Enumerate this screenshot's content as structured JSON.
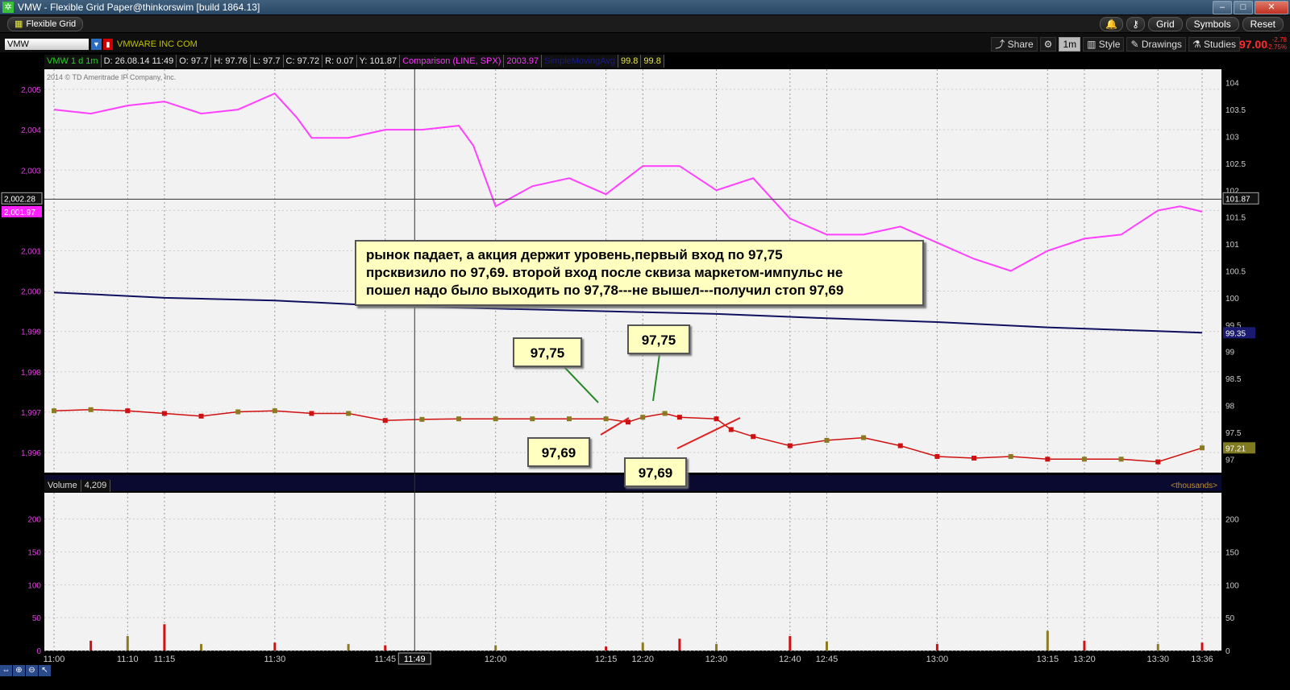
{
  "window": {
    "title": "VMW - Flexible Grid Paper@thinkorswim [build 1864.13]",
    "app_icon": "thinkorswim-icon"
  },
  "toolbar": {
    "grid_tab": "Flexible Grid",
    "buttons": [
      "Grid",
      "Symbols",
      "Reset"
    ],
    "symbol": "VMW",
    "symbol_name": "VMWARE INC COM",
    "share": "Share",
    "interval": "1m",
    "style": "Style",
    "drawings": "Drawings",
    "studies": "Studies",
    "last_price": "97.00",
    "change": "-2.78",
    "change_pct": "-2.75%"
  },
  "info_bar": {
    "label": "VMW 1 d 1m",
    "date": "D: 26.08.14 11:49",
    "open": "O: 97.7",
    "high": "H: 97.76",
    "low": "L: 97.7",
    "close": "C: 97.72",
    "range": "R: 0.07",
    "y": "Y: 101.87",
    "comparison": "Comparison (LINE, SPX)",
    "comparison_value": "2003.97",
    "ma_label": "SimpleMovingAvg",
    "v1": "99.8",
    "v2": "99.8"
  },
  "copyright": "2014 © TD Ameritrade IP Company, Inc.",
  "colors": {
    "comparison_line": "#ff40ff",
    "moving_average": "#101060",
    "up_candle": "#8a7a20",
    "down_candle": "#d01010",
    "price_tag": "#ff20ff",
    "accent_red": "#ff2a2a",
    "panel_bg": "#f2f2f2"
  },
  "left_axis": [
    "2,005",
    "2,004",
    "2,003",
    "2,002",
    "2,001",
    "2,000",
    "1,999",
    "1,998",
    "1,997",
    "1,996"
  ],
  "right_axis": [
    "104",
    "103.5",
    "103",
    "102.5",
    "102",
    "101.5",
    "101",
    "100.5",
    "100",
    "99.5",
    "99",
    "98.5",
    "98",
    "97.5",
    "97"
  ],
  "price_tags": {
    "crosshair_left": "2,002.28",
    "comparison_left": "2,001.97",
    "crosshair_right": "101.87",
    "ma_right": "99.35",
    "close_right": "97.21"
  },
  "annotation": {
    "lines": [
      "рынок падает, а акция держит уровень,первый вход по 97,75",
      "прсквизило по 97,69. второй вход после сквиза маркетом-импульс не",
      "пошел надо было выходить по 97,78---не вышел---получил стоп 97,69"
    ]
  },
  "tags": [
    "97,75",
    "97,75",
    "97,69",
    "97,69"
  ],
  "volume": {
    "label": "Volume",
    "value": "4,209",
    "unit": "<thousands>",
    "axis": [
      "200",
      "150",
      "100",
      "50",
      "0"
    ]
  },
  "time_axis": [
    "11:00",
    "11:10",
    "11:15",
    "11:30",
    "11:45",
    "12:00",
    "12:15",
    "12:20",
    "12:30",
    "12:40",
    "12:45",
    "13:00",
    "13:15",
    "13:20",
    "13:30",
    "13:36"
  ],
  "crosshair_time": "11:49",
  "chart_data": {
    "type": "line",
    "title": "VMW 1 d 1m",
    "x_range": [
      "11:00",
      "13:36"
    ],
    "series": [
      {
        "name": "Comparison (LINE, SPX)",
        "axis": "left",
        "x": [
          "11:00",
          "11:05",
          "11:10",
          "11:15",
          "11:20",
          "11:25",
          "11:30",
          "11:33",
          "11:35",
          "11:40",
          "11:45",
          "11:50",
          "11:55",
          "11:57",
          "12:00",
          "12:05",
          "12:10",
          "12:15",
          "12:20",
          "12:25",
          "12:30",
          "12:35",
          "12:40",
          "12:45",
          "12:50",
          "12:55",
          "13:00",
          "13:05",
          "13:10",
          "13:15",
          "13:20",
          "13:25",
          "13:30",
          "13:33",
          "13:36"
        ],
        "values": [
          2004.5,
          2004.4,
          2004.6,
          2004.7,
          2004.4,
          2004.5,
          2004.9,
          2004.3,
          2003.8,
          2003.8,
          2004.0,
          2004.0,
          2004.1,
          2003.6,
          2002.1,
          2002.6,
          2002.8,
          2002.4,
          2003.1,
          2003.1,
          2002.5,
          2002.8,
          2001.8,
          2001.4,
          2001.4,
          2001.6,
          2001.2,
          2000.8,
          2000.5,
          2001.0,
          2001.3,
          2001.4,
          2002.0,
          2002.1,
          2001.97
        ]
      },
      {
        "name": "SimpleMovingAvg",
        "axis": "right",
        "x": [
          "11:00",
          "11:15",
          "11:30",
          "11:45",
          "12:00",
          "12:15",
          "12:30",
          "12:45",
          "13:00",
          "13:15",
          "13:30",
          "13:36"
        ],
        "values": [
          100.1,
          100.0,
          99.95,
          99.85,
          99.8,
          99.75,
          99.7,
          99.62,
          99.55,
          99.45,
          99.38,
          99.35
        ]
      },
      {
        "name": "VMW",
        "axis": "right",
        "x": [
          "11:00",
          "11:05",
          "11:10",
          "11:15",
          "11:20",
          "11:25",
          "11:30",
          "11:35",
          "11:40",
          "11:45",
          "11:50",
          "11:55",
          "12:00",
          "12:05",
          "12:10",
          "12:15",
          "12:18",
          "12:20",
          "12:23",
          "12:25",
          "12:30",
          "12:32",
          "12:35",
          "12:40",
          "12:45",
          "12:50",
          "12:55",
          "13:00",
          "13:05",
          "13:10",
          "13:15",
          "13:20",
          "13:25",
          "13:30",
          "13:36"
        ],
        "values": [
          97.9,
          97.92,
          97.9,
          97.85,
          97.8,
          97.88,
          97.9,
          97.85,
          97.85,
          97.72,
          97.74,
          97.75,
          97.75,
          97.75,
          97.75,
          97.75,
          97.69,
          97.78,
          97.85,
          97.78,
          97.75,
          97.55,
          97.42,
          97.25,
          97.35,
          97.4,
          97.25,
          97.05,
          97.02,
          97.05,
          97.0,
          97.0,
          97.0,
          96.95,
          97.21
        ]
      }
    ],
    "volume": {
      "x": [
        "11:05",
        "11:10",
        "11:15",
        "11:20",
        "11:30",
        "11:40",
        "11:45",
        "12:00",
        "12:15",
        "12:20",
        "12:25",
        "12:30",
        "12:40",
        "12:45",
        "13:00",
        "13:15",
        "13:20",
        "13:30",
        "13:36"
      ],
      "values": [
        15,
        22,
        40,
        10,
        12,
        10,
        8,
        8,
        6,
        12,
        18,
        10,
        22,
        14,
        10,
        30,
        15,
        10,
        12
      ]
    },
    "left_ylim": [
      1995.5,
      2005.5
    ],
    "right_ylim": [
      96.75,
      104.25
    ],
    "volume_ylim": [
      0,
      240
    ],
    "grid": true
  }
}
